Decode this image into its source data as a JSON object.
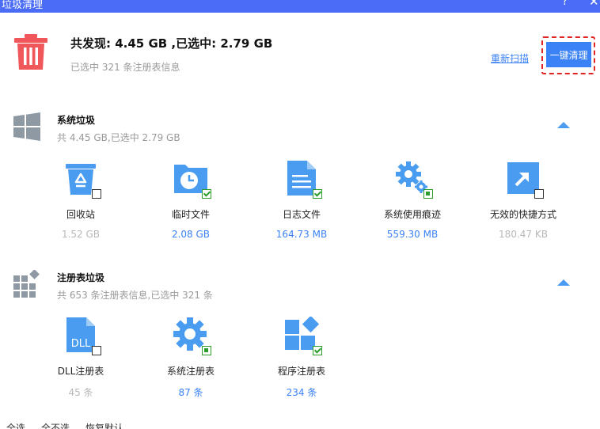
{
  "window": {
    "title": "垃圾清理",
    "help": "?",
    "close": "✕"
  },
  "summary": {
    "found_text": "共发现: 4.45 GB ,已选中: 2.79 GB",
    "registry_selected_text": "已选中 321 条注册表信息",
    "rescan_label": "重新扫描",
    "clean_label": "一键清理"
  },
  "system_junk": {
    "title": "系统垃圾",
    "subtitle": "共 4.45 GB,已选中 2.79 GB",
    "items": [
      {
        "label": "回收站",
        "size": "1.52 GB",
        "checked": false,
        "icon": "recycle-bin-icon"
      },
      {
        "label": "临时文件",
        "size": "2.08 GB",
        "checked": true,
        "icon": "temp-folder-clock-icon"
      },
      {
        "label": "日志文件",
        "size": "164.73 MB",
        "checked": true,
        "icon": "log-document-icon"
      },
      {
        "label": "系统使用痕迹",
        "size": "559.30 MB",
        "checked": "partial",
        "icon": "gears-icon"
      },
      {
        "label": "无效的快捷方式",
        "size": "180.47 KB",
        "checked": false,
        "icon": "shortcut-arrow-icon"
      }
    ]
  },
  "registry_junk": {
    "title": "注册表垃圾",
    "subtitle": "共 653 条注册表信息,已选中 321 条",
    "items": [
      {
        "label": "DLL注册表",
        "size": "45 条",
        "checked": false,
        "icon": "dll-file-icon"
      },
      {
        "label": "系统注册表",
        "size": "87 条",
        "checked": "partial",
        "icon": "gear-icon"
      },
      {
        "label": "程序注册表",
        "size": "234 条",
        "checked": true,
        "icon": "app-blocks-icon"
      }
    ]
  },
  "footer": {
    "select_all": "全选",
    "select_none": "全不选",
    "restore_default": "恢复默认"
  },
  "colors": {
    "titlebar": "#4a6cf7",
    "accent": "#3b82f6",
    "trash": "#f0575a",
    "check": "#2a9d2a",
    "highlight": "#e02424"
  }
}
